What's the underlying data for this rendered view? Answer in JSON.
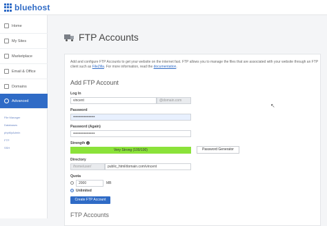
{
  "brand": {
    "name": "bluehost",
    "color": "#2f6bc6"
  },
  "sidebar": {
    "items": [
      {
        "label": "Home",
        "icon": "home-icon"
      },
      {
        "label": "My Sites",
        "icon": "wordpress-icon"
      },
      {
        "label": "Marketplace",
        "icon": "store-icon"
      },
      {
        "label": "Email & Office",
        "icon": "mail-icon"
      },
      {
        "label": "Domains",
        "icon": "globe-icon"
      },
      {
        "label": "Advanced",
        "icon": "gear-icon"
      }
    ],
    "subitems": [
      "File Manager",
      "Databases",
      "phpMyAdmin",
      "FTP",
      "SSH"
    ]
  },
  "page": {
    "title": "FTP Accounts",
    "intro_text": "Add and configure FTP Accounts to get your website on the internet fast. FTP allows you to manage the files that are associated with your website through an FTP client such as ",
    "intro_link": "FileZilla",
    "intro_mid": ". For more information, read the ",
    "intro_link2": "documentation",
    "intro_end": "."
  },
  "form": {
    "section_title": "Add FTP Account",
    "login_label": "Log In",
    "login_value": "vincent",
    "login_suffix": "@domain.com",
    "password_label": "Password",
    "password_value": "••••••••••••••••••",
    "password_again_label": "Password (Again)",
    "password_again_value": "••••••••••••••••••",
    "strength_label": "Strength",
    "strength_value": "Very Strong (100/100)",
    "password_generator_label": "Password Generator",
    "directory_label": "Directory",
    "directory_prefix": "/home/user/",
    "directory_value": "public_html/domain.com/vincent",
    "quota_label": "Quota",
    "quota_value": "2000",
    "quota_unit": "MB",
    "unlimited_label": "Unlimited",
    "create_button_label": "Create FTP Account"
  },
  "list_section_title": "FTP Accounts"
}
